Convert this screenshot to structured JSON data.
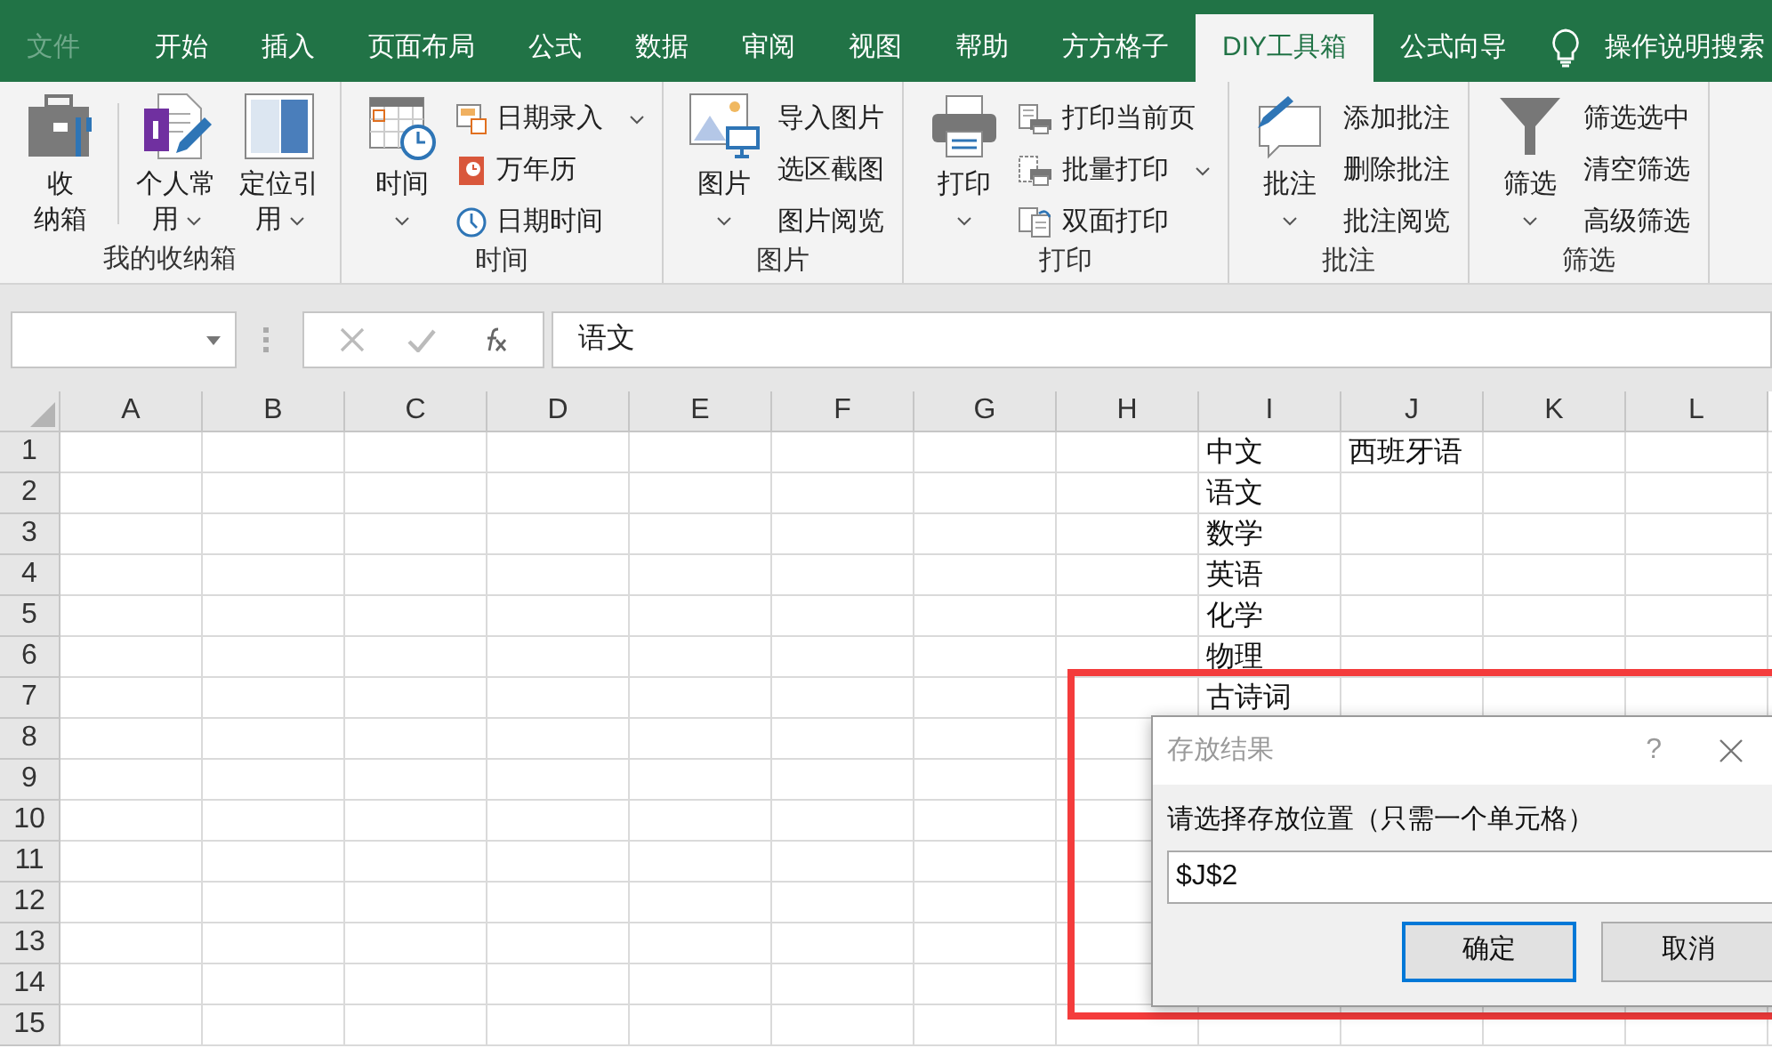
{
  "menu_tabs": [
    {
      "label": "文件",
      "kind": "file",
      "selected": false
    },
    {
      "label": "开始",
      "kind": "tab",
      "selected": false
    },
    {
      "label": "插入",
      "kind": "tab",
      "selected": false
    },
    {
      "label": "页面布局",
      "kind": "tab",
      "selected": false
    },
    {
      "label": "公式",
      "kind": "tab",
      "selected": false
    },
    {
      "label": "数据",
      "kind": "tab",
      "selected": false
    },
    {
      "label": "审阅",
      "kind": "tab",
      "selected": false
    },
    {
      "label": "视图",
      "kind": "tab",
      "selected": false
    },
    {
      "label": "帮助",
      "kind": "tab",
      "selected": false
    },
    {
      "label": "方方格子",
      "kind": "tab",
      "selected": false
    },
    {
      "label": "DIY工具箱",
      "kind": "tab",
      "selected": true
    },
    {
      "label": "公式向导",
      "kind": "tab",
      "selected": false
    }
  ],
  "tell_me": {
    "label": "操作说明搜索"
  },
  "ribbon_groups": [
    {
      "label": "我的收纳箱",
      "items": [
        {
          "kind": "large",
          "lines": [
            "收",
            "纳箱"
          ],
          "dropdown": false
        },
        {
          "kind": "large",
          "lines": [
            "个人常",
            "用"
          ],
          "dropdown": true
        },
        {
          "kind": "large",
          "lines": [
            "定位引",
            "用"
          ],
          "dropdown": true
        }
      ]
    },
    {
      "label": "时间",
      "items": [
        {
          "kind": "large",
          "lines": [
            "时间"
          ],
          "dropdown": true
        },
        {
          "kind": "small-icon",
          "lines": [
            "日期录入"
          ],
          "dropdown": true
        },
        {
          "kind": "small-icon",
          "lines": [
            "万年历"
          ],
          "dropdown": false
        },
        {
          "kind": "small-icon",
          "lines": [
            "日期时间"
          ],
          "dropdown": false
        }
      ]
    },
    {
      "label": "图片",
      "items": [
        {
          "kind": "large",
          "lines": [
            "图片"
          ],
          "dropdown": true
        },
        {
          "kind": "small",
          "lines": [
            "导入图片"
          ],
          "dropdown": false
        },
        {
          "kind": "small",
          "lines": [
            "选区截图"
          ],
          "dropdown": false
        },
        {
          "kind": "small",
          "lines": [
            "图片阅览"
          ],
          "dropdown": false
        }
      ]
    },
    {
      "label": "打印",
      "items": [
        {
          "kind": "large",
          "lines": [
            "打印"
          ],
          "dropdown": true
        },
        {
          "kind": "small-icon",
          "lines": [
            "打印当前页"
          ],
          "dropdown": false
        },
        {
          "kind": "small-icon",
          "lines": [
            "批量打印"
          ],
          "dropdown": true
        },
        {
          "kind": "small-icon",
          "lines": [
            "双面打印"
          ],
          "dropdown": false
        }
      ]
    },
    {
      "label": "批注",
      "items": [
        {
          "kind": "large",
          "lines": [
            "批注"
          ],
          "dropdown": true
        },
        {
          "kind": "small",
          "lines": [
            "添加批注"
          ],
          "dropdown": false
        },
        {
          "kind": "small",
          "lines": [
            "删除批注"
          ],
          "dropdown": false
        },
        {
          "kind": "small",
          "lines": [
            "批注阅览"
          ],
          "dropdown": false
        }
      ]
    },
    {
      "label": "筛选",
      "items": [
        {
          "kind": "large",
          "lines": [
            "筛选"
          ],
          "dropdown": true
        },
        {
          "kind": "small",
          "lines": [
            "筛选选中"
          ],
          "dropdown": false
        },
        {
          "kind": "small",
          "lines": [
            "清空筛选"
          ],
          "dropdown": false
        },
        {
          "kind": "small",
          "lines": [
            "高级筛选"
          ],
          "dropdown": false
        }
      ]
    }
  ],
  "formula_bar": {
    "value": "语文"
  },
  "sheet": {
    "columns": [
      "A",
      "B",
      "C",
      "D",
      "E",
      "F",
      "G",
      "H",
      "I",
      "J",
      "K",
      "L"
    ],
    "rows": [
      {
        "header": "1",
        "cells": [
          null,
          null,
          null,
          null,
          null,
          null,
          null,
          null,
          "中文",
          "西班牙语"
        ]
      },
      {
        "header": "2",
        "cells": [
          null,
          null,
          null,
          null,
          null,
          null,
          null,
          null,
          "语文"
        ]
      },
      {
        "header": "3",
        "cells": [
          null,
          null,
          null,
          null,
          null,
          null,
          null,
          null,
          "数学"
        ]
      },
      {
        "header": "4",
        "cells": [
          null,
          null,
          null,
          null,
          null,
          null,
          null,
          null,
          "英语"
        ]
      },
      {
        "header": "5",
        "cells": [
          null,
          null,
          null,
          null,
          null,
          null,
          null,
          null,
          "化学"
        ]
      },
      {
        "header": "6",
        "cells": [
          null,
          null,
          null,
          null,
          null,
          null,
          null,
          null,
          "物理"
        ]
      },
      {
        "header": "7",
        "cells": [
          null,
          null,
          null,
          null,
          null,
          null,
          null,
          null,
          "古诗词"
        ]
      },
      {
        "header": "8",
        "cells": []
      },
      {
        "header": "9",
        "cells": []
      },
      {
        "header": "10",
        "cells": []
      },
      {
        "header": "11",
        "cells": []
      },
      {
        "header": "12",
        "cells": []
      },
      {
        "header": "13",
        "cells": []
      },
      {
        "header": "14",
        "cells": []
      },
      {
        "header": "15",
        "cells": []
      }
    ]
  },
  "dialog": {
    "title": "存放结果",
    "help": "?",
    "prompt": "请选择存放位置（只需一个单元格）",
    "value": "$J$2",
    "buttons": [
      {
        "label": "确定",
        "focused": true
      },
      {
        "label": "取消",
        "focused": false
      }
    ]
  },
  "annotations": [
    {
      "kind": "frame"
    }
  ]
}
